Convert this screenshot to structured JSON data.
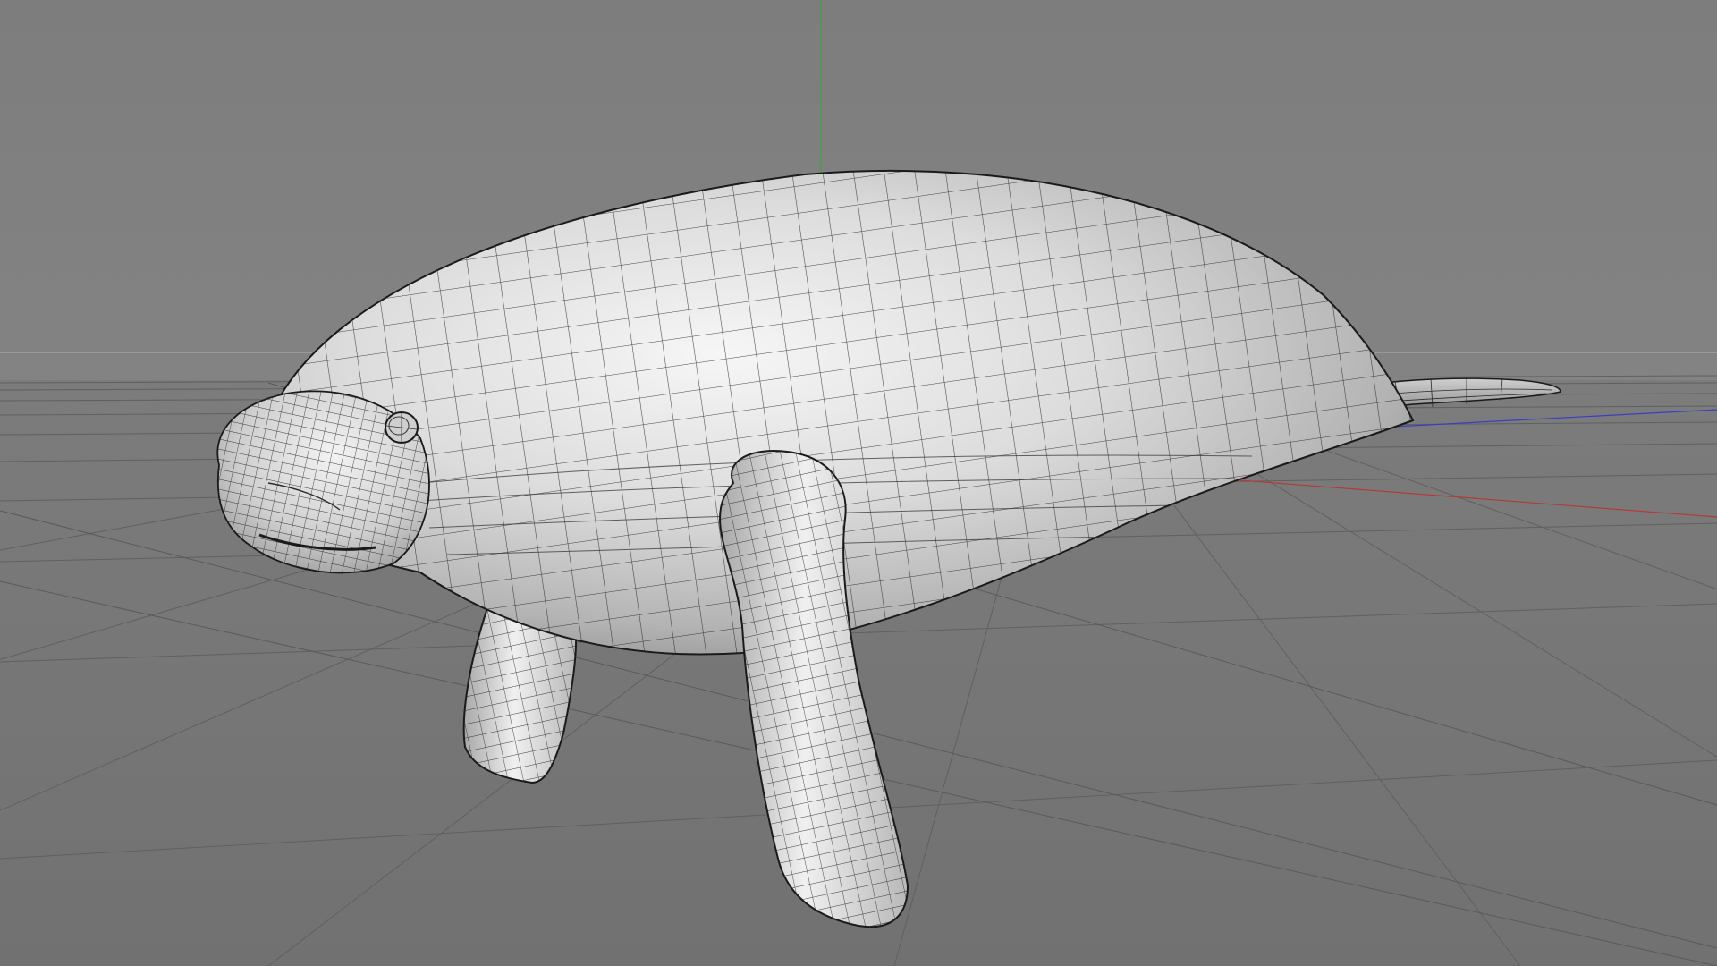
{
  "viewport": {
    "view": "perspective",
    "display_mode": "gouraud-shading-wireframe",
    "colors": {
      "background_top": "#808080",
      "background_horizon": "#7e7e7e",
      "floor": "#777777",
      "grid_line": "#5f5f5f",
      "horizon_line": "#a9a9a9",
      "axis_x": "#b33a3a",
      "axis_y": "#3fa43f",
      "axis_z": "#3d3dc0",
      "mesh_fill_light": "#f2f2f2",
      "mesh_fill_dark": "#8a8a8a",
      "wire": "#1c1c1c"
    }
  },
  "model": {
    "object_icon": "manatee-mesh-icon",
    "parts": [
      "body",
      "head",
      "eye",
      "left-flipper",
      "right-flipper",
      "tail"
    ]
  }
}
